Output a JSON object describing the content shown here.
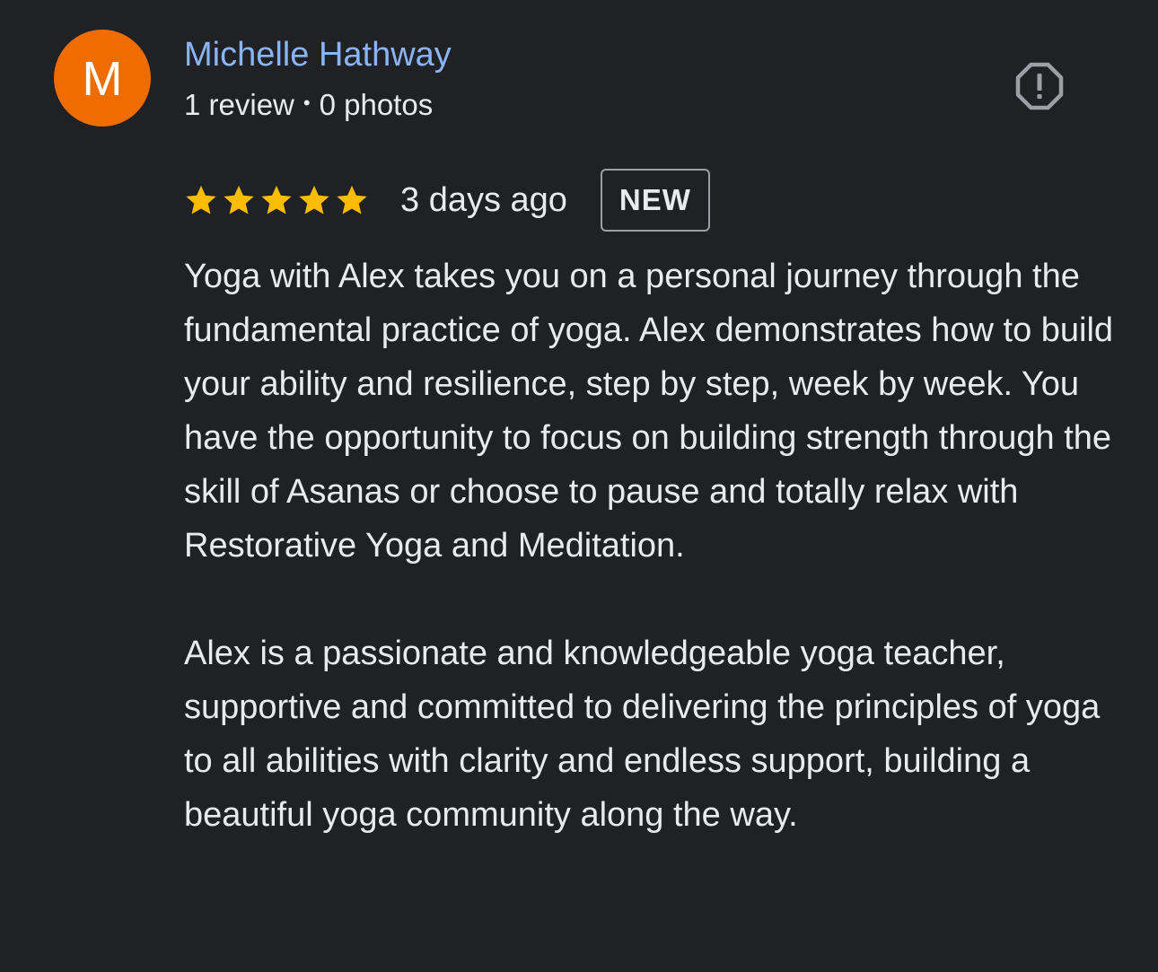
{
  "reviewer": {
    "initial": "M",
    "avatar_color": "#ef6c00",
    "name": "Michelle Hathway",
    "review_count": "1 review",
    "separator": "•",
    "photo_count": "0 photos"
  },
  "report": {
    "icon": "report-flag-icon"
  },
  "rating": {
    "stars": 5,
    "max_stars": 5,
    "star_color": "#fbbc04",
    "date": "3 days ago",
    "badge": "NEW"
  },
  "review": {
    "paragraphs": [
      "Yoga with Alex takes you on a personal journey through the fundamental practice of yoga. Alex demonstrates how to build your ability and resilience, step by step, week by week. You have the opportunity to focus on building strength through the skill of Asanas or choose to pause and totally relax with Restorative Yoga and Meditation.",
      "Alex is a passionate and knowledgeable yoga teacher, supportive and committed to delivering the principles of yoga to all abilities with clarity and endless support, building a beautiful yoga community along the way."
    ]
  },
  "colors": {
    "background": "#202124",
    "name_link": "#8ab4f8",
    "text": "#e8eaed",
    "badge_border": "#9aa0a6"
  }
}
